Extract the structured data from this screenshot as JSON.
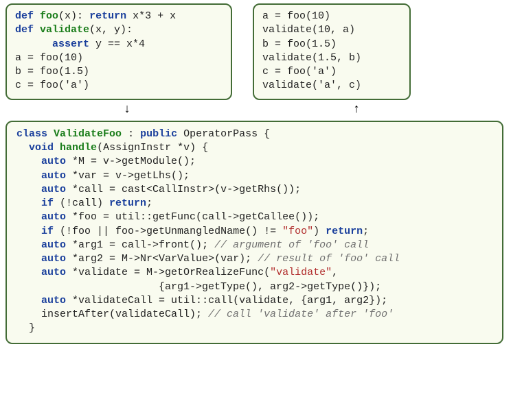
{
  "top_left": {
    "l1_kw1": "def",
    "l1_fn": "foo",
    "l1_rest": "(x): ",
    "l1_kw2": "return",
    "l1_tail": " x*3 + x",
    "l2_kw": "def",
    "l2_fn": "validate",
    "l2_tail": "(x, y):",
    "l3_indent": "      ",
    "l3_kw": "assert",
    "l3_tail": " y == x*4",
    "l4": "a = foo(10)",
    "l5": "b = foo(1.5)",
    "l6": "c = foo('a')"
  },
  "top_right": {
    "l1": "a = foo(10)",
    "l2": "validate(10, a)",
    "l3": "b = foo(1.5)",
    "l4": "validate(1.5, b)",
    "l5": "c = foo('a')",
    "l6": "validate('a', c)"
  },
  "arrows": {
    "down": "↓",
    "up": "↑"
  },
  "bottom": {
    "l1_kw1": "class",
    "l1_name": "ValidateFoo",
    "l1_mid": " : ",
    "l1_kw2": "public",
    "l1_tail": " OperatorPass {",
    "l2_pre": "  ",
    "l2_kw": "void",
    "l2_name": "handle",
    "l2_tail": "(AssignInstr *v) {",
    "l3_pre": "    ",
    "l3_kw": "auto",
    "l3_tail": " *M = v->getModule();",
    "l4_pre": "    ",
    "l4_kw": "auto",
    "l4_tail": " *var = v->getLhs();",
    "l5_pre": "    ",
    "l5_kw": "auto",
    "l5_tail": " *call = cast<CallInstr>(v->getRhs());",
    "l6_pre": "    ",
    "l6_kw": "if",
    "l6_mid": " (!call) ",
    "l6_kw2": "return",
    "l6_tail": ";",
    "l7_pre": "    ",
    "l7_kw": "auto",
    "l7_tail": " *foo = util::getFunc(call->getCallee());",
    "l8_pre": "    ",
    "l8_kw": "if",
    "l8_mid": " (!foo || foo->getUnmangledName() != ",
    "l8_str": "\"foo\"",
    "l8_close": ") ",
    "l8_kw2": "return",
    "l8_tail": ";",
    "l9_pre": "    ",
    "l9_kw": "auto",
    "l9_tail": " *arg1 = call->front(); ",
    "l9_cmt": "// argument of 'foo' call",
    "l10_pre": "    ",
    "l10_kw": "auto",
    "l10_tail": " *arg2 = M->Nr<VarValue>(var); ",
    "l10_cmt": "// result of 'foo' call",
    "l11_pre": "    ",
    "l11_kw": "auto",
    "l11_tail": " *validate = M->getOrRealizeFunc(",
    "l11_str": "\"validate\"",
    "l11_tail2": ",",
    "l12": "                       {arg1->getType(), arg2->getType()});",
    "l13_pre": "    ",
    "l13_kw": "auto",
    "l13_tail": " *validateCall = util::call(validate, {arg1, arg2});",
    "l14_pre": "    insertAfter(validateCall); ",
    "l14_cmt": "// call 'validate' after 'foo'",
    "l15": "  }"
  }
}
